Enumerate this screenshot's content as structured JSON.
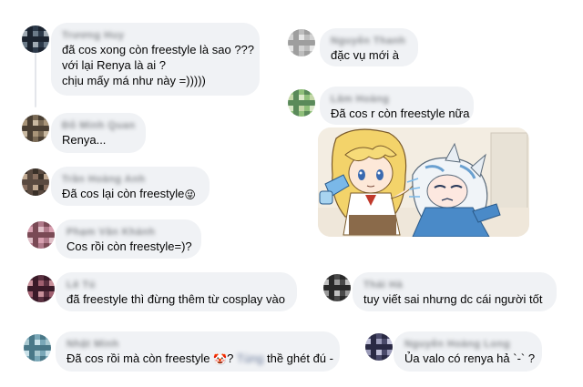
{
  "comments": [
    {
      "id": "c1",
      "name": "Trương Huy",
      "lines": [
        "đã cos xong còn freestyle là sao ???",
        "với lại Renya là ai ?",
        "chịu mấy má như này =)))))"
      ],
      "avatar_colors": [
        "#2d3a4a",
        "#6b7a88",
        "#1c2430",
        "#a0aab3"
      ]
    },
    {
      "id": "c2",
      "name": "Nguyễn Thanh Hà",
      "lines": [
        "đặc vụ mới à"
      ],
      "avatar_colors": [
        "#bdbdbd",
        "#e6e6e6",
        "#9e9e9e",
        "#d2d2d2"
      ]
    },
    {
      "id": "c3",
      "name": "Lâm Hoàng",
      "lines": [
        "Đã cos r còn freestyle nữa"
      ],
      "avatar_colors": [
        "#8fbf7a",
        "#d9e8c8",
        "#5a8a5a",
        "#c4d7a8"
      ]
    },
    {
      "id": "c4",
      "name": "Đỗ Minh Quang",
      "lines": [
        "Renya..."
      ],
      "avatar_colors": [
        "#7a6a55",
        "#c8b8a0",
        "#4a3f33",
        "#a89478"
      ]
    },
    {
      "id": "c5",
      "name": "Trần Hoàng Anh",
      "lines": [
        "Đã cos lại còn freestyle"
      ],
      "emoji": "😜",
      "avatar_colors": [
        "#3a3028",
        "#8a7060",
        "#5a4a40",
        "#c0a890"
      ]
    },
    {
      "id": "c6",
      "name": "Phạm Văn Khánh",
      "lines": [
        "Cos rồi còn freestyle=)?"
      ],
      "avatar_colors": [
        "#b07a8a",
        "#e0c0c8",
        "#7a4a55",
        "#d8a0b0"
      ]
    },
    {
      "id": "c7",
      "name": "Lê Tú",
      "lines": [
        "đã freestyle thì đừng thêm từ cosplay vào"
      ],
      "avatar_colors": [
        "#5a3040",
        "#a06070",
        "#3a1a28",
        "#c8909a"
      ]
    },
    {
      "id": "c8",
      "name": "Thái Hà",
      "lines": [
        "tuy viết sai nhưng dc cái người tốt"
      ],
      "avatar_colors": [
        "#4a4a4a",
        "#9a9a9a",
        "#2a2a2a",
        "#c0c0c0"
      ]
    },
    {
      "id": "c9",
      "name": "Nhật Minh",
      "lines": [
        "Đã cos rồi mà còn freestyle"
      ],
      "emoji": "🤡",
      "tail_prefix": "?",
      "tail_tag": "Tùng",
      "tail_text": "thề ghét đú",
      "tail_suffix": "-",
      "avatar_colors": [
        "#7aa8b8",
        "#c8e0e8",
        "#4a7888",
        "#a8c8d0"
      ]
    },
    {
      "id": "c10",
      "name": "Nguyễn Hoàng Long",
      "lines": [
        "Ủa valo có renya hả `-` ?"
      ],
      "avatar_colors": [
        "#4a4a6a",
        "#9a9ab8",
        "#2a2a44",
        "#c0c0d8"
      ]
    }
  ],
  "sticker": {
    "characters": [
      "blonde-girl-character",
      "white-haired-girl-character"
    ]
  },
  "colors": {
    "bubble": "#f0f2f5",
    "text": "#050505",
    "name": "#8a8d91"
  }
}
